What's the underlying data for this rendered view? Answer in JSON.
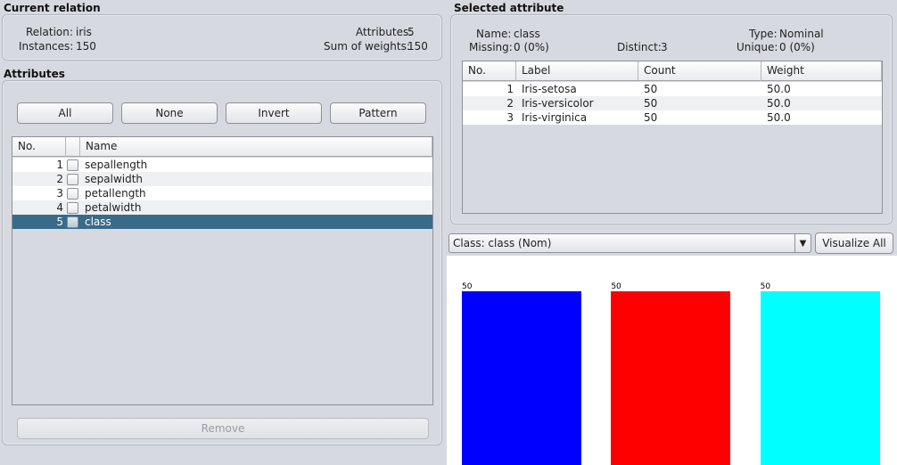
{
  "current_relation": {
    "title": "Current relation",
    "relation_label": "Relation:",
    "relation_value": "iris",
    "instances_label": "Instances:",
    "instances_value": "150",
    "attributes_label": "Attributes:",
    "attributes_value": "5",
    "weights_label": "Sum of weights:",
    "weights_value": "150"
  },
  "attributes": {
    "title": "Attributes",
    "buttons": {
      "all": "All",
      "none": "None",
      "invert": "Invert",
      "pattern": "Pattern"
    },
    "columns": {
      "no": "No.",
      "name": "Name"
    },
    "rows": [
      {
        "no": "1",
        "name": "sepallength"
      },
      {
        "no": "2",
        "name": "sepalwidth"
      },
      {
        "no": "3",
        "name": "petallength"
      },
      {
        "no": "4",
        "name": "petalwidth"
      },
      {
        "no": "5",
        "name": "class"
      }
    ],
    "remove_label": "Remove"
  },
  "selected_attribute": {
    "title": "Selected attribute",
    "name_label": "Name:",
    "name_value": "class",
    "type_label": "Type:",
    "type_value": "Nominal",
    "missing_label": "Missing:",
    "missing_value": "0 (0%)",
    "distinct_label": "Distinct:",
    "distinct_value": "3",
    "unique_label": "Unique:",
    "unique_value": "0 (0%)",
    "columns": {
      "no": "No.",
      "label": "Label",
      "count": "Count",
      "weight": "Weight"
    },
    "rows": [
      {
        "no": "1",
        "label": "Iris-setosa",
        "count": "50",
        "weight": "50.0"
      },
      {
        "no": "2",
        "label": "Iris-versicolor",
        "count": "50",
        "weight": "50.0"
      },
      {
        "no": "3",
        "label": "Iris-virginica",
        "count": "50",
        "weight": "50.0"
      }
    ]
  },
  "class_selector": {
    "value": "Class: class (Nom)",
    "visualize_label": "Visualize All"
  },
  "chart_data": {
    "type": "bar",
    "categories": [
      "Iris-setosa",
      "Iris-versicolor",
      "Iris-virginica"
    ],
    "values": [
      50,
      50,
      50
    ],
    "ylim": [
      0,
      50
    ],
    "colors": [
      "#0000ff",
      "#ff0000",
      "#00ffff"
    ]
  }
}
